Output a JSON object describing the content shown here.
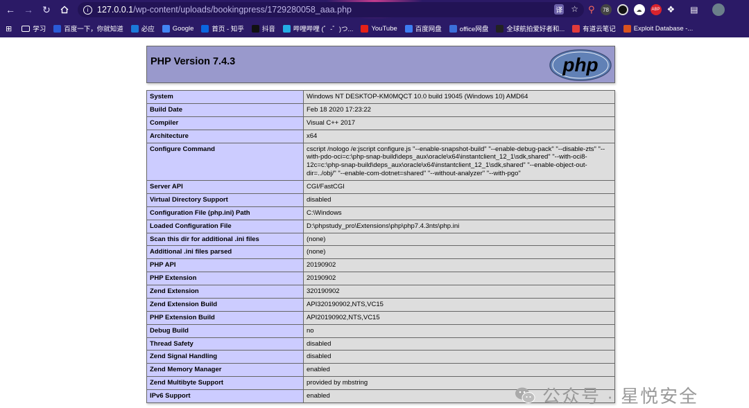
{
  "browser": {
    "url_host": "127.0.0.1",
    "url_path": "/wp-content/uploads/bookingpress/1729280058_aaa.php",
    "ext_badge": "78",
    "abp_label": "ABP"
  },
  "bookmarks": [
    {
      "label": "学习",
      "icon": "folder-icon",
      "color": "transparent"
    },
    {
      "label": "百度一下，你就知道",
      "icon": "baidu-icon",
      "color": "#2a5bd7"
    },
    {
      "label": "必应",
      "icon": "bing-icon",
      "color": "#1b7ad9"
    },
    {
      "label": "Google",
      "icon": "google-icon",
      "color": "#4285f4"
    },
    {
      "label": "首页 - 知乎",
      "icon": "zhihu-icon",
      "color": "#0a66e0"
    },
    {
      "label": "抖音",
      "icon": "douyin-icon",
      "color": "#111"
    },
    {
      "label": "哔哩哔哩 (゜-゜)つ...",
      "icon": "bilibili-icon",
      "color": "#23ade5"
    },
    {
      "label": "YouTube",
      "icon": "youtube-icon",
      "color": "#e62117"
    },
    {
      "label": "百度网盘",
      "icon": "baidupan-icon",
      "color": "#3d7df2"
    },
    {
      "label": "office网盘",
      "icon": "office-icon",
      "color": "#3b6fd9"
    },
    {
      "label": "全球航拍爱好者和...",
      "icon": "skypixel-icon",
      "color": "#222"
    },
    {
      "label": "有道云笔记",
      "icon": "youdao-icon",
      "color": "#e23b3b"
    },
    {
      "label": "Exploit Database -...",
      "icon": "exploitdb-icon",
      "color": "#d9531e"
    }
  ],
  "phpinfo": {
    "title": "PHP Version 7.4.3",
    "logo_text": "php",
    "rows": [
      {
        "k": "System",
        "v": "Windows NT DESKTOP-KM0MQCT 10.0 build 19045 (Windows 10) AMD64"
      },
      {
        "k": "Build Date",
        "v": "Feb 18 2020 17:23:22"
      },
      {
        "k": "Compiler",
        "v": "Visual C++ 2017"
      },
      {
        "k": "Architecture",
        "v": "x64"
      },
      {
        "k": "Configure Command",
        "v": "cscript /nologo /e:jscript configure.js \"--enable-snapshot-build\" \"--enable-debug-pack\" \"--disable-zts\" \"--with-pdo-oci=c:\\php-snap-build\\deps_aux\\oracle\\x64\\instantclient_12_1\\sdk,shared\" \"--with-oci8-12c=c:\\php-snap-build\\deps_aux\\oracle\\x64\\instantclient_12_1\\sdk,shared\" \"--enable-object-out-dir=../obj/\" \"--enable-com-dotnet=shared\" \"--without-analyzer\" \"--with-pgo\""
      },
      {
        "k": "Server API",
        "v": "CGI/FastCGI"
      },
      {
        "k": "Virtual Directory Support",
        "v": "disabled"
      },
      {
        "k": "Configuration File (php.ini) Path",
        "v": "C:\\Windows"
      },
      {
        "k": "Loaded Configuration File",
        "v": "D:\\phpstudy_pro\\Extensions\\php\\php7.4.3nts\\php.ini"
      },
      {
        "k": "Scan this dir for additional .ini files",
        "v": "(none)"
      },
      {
        "k": "Additional .ini files parsed",
        "v": "(none)"
      },
      {
        "k": "PHP API",
        "v": "20190902"
      },
      {
        "k": "PHP Extension",
        "v": "20190902"
      },
      {
        "k": "Zend Extension",
        "v": "320190902"
      },
      {
        "k": "Zend Extension Build",
        "v": "API320190902,NTS,VC15"
      },
      {
        "k": "PHP Extension Build",
        "v": "API20190902,NTS,VC15"
      },
      {
        "k": "Debug Build",
        "v": "no"
      },
      {
        "k": "Thread Safety",
        "v": "disabled"
      },
      {
        "k": "Zend Signal Handling",
        "v": "disabled"
      },
      {
        "k": "Zend Memory Manager",
        "v": "enabled"
      },
      {
        "k": "Zend Multibyte Support",
        "v": "provided by mbstring"
      },
      {
        "k": "IPv6 Support",
        "v": "enabled"
      }
    ]
  },
  "watermark": {
    "text": "公众号 · 星悦安全"
  }
}
